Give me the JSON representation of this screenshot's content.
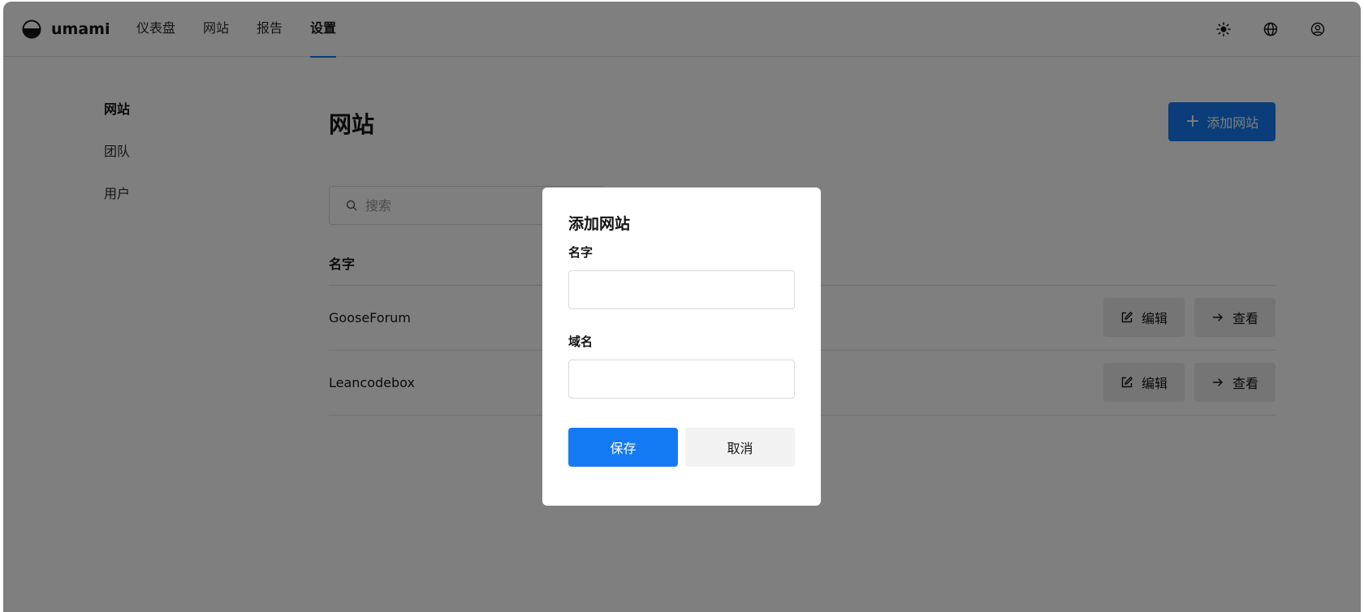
{
  "app": {
    "name": "umami"
  },
  "nav": {
    "items": [
      {
        "label": "仪表盘"
      },
      {
        "label": "网站"
      },
      {
        "label": "报告"
      },
      {
        "label": "设置"
      }
    ],
    "active": "设置"
  },
  "header_tools": {
    "icons": [
      "sun-icon",
      "globe-icon",
      "user-circle-icon"
    ]
  },
  "sidebar": {
    "items": [
      {
        "label": "网站"
      },
      {
        "label": "团队"
      },
      {
        "label": "用户"
      }
    ],
    "active": "网站"
  },
  "main": {
    "title": "网站",
    "add_button_label": "添加网站",
    "search": {
      "placeholder": "搜索",
      "value": ""
    },
    "table": {
      "column_name": "名字",
      "rows": [
        {
          "name": "GooseForum",
          "edit_label": "编辑",
          "view_label": "查看"
        },
        {
          "name": "Leancodebox",
          "edit_label": "编辑",
          "view_label": "查看"
        }
      ]
    }
  },
  "modal": {
    "title": "添加网站",
    "name_label": "名字",
    "name_value": "",
    "domain_label": "域名",
    "domain_value": "",
    "save_label": "保存",
    "cancel_label": "取消"
  },
  "colors": {
    "accent": "#147af3",
    "overlay": "rgba(0,0,0,0.5)"
  }
}
